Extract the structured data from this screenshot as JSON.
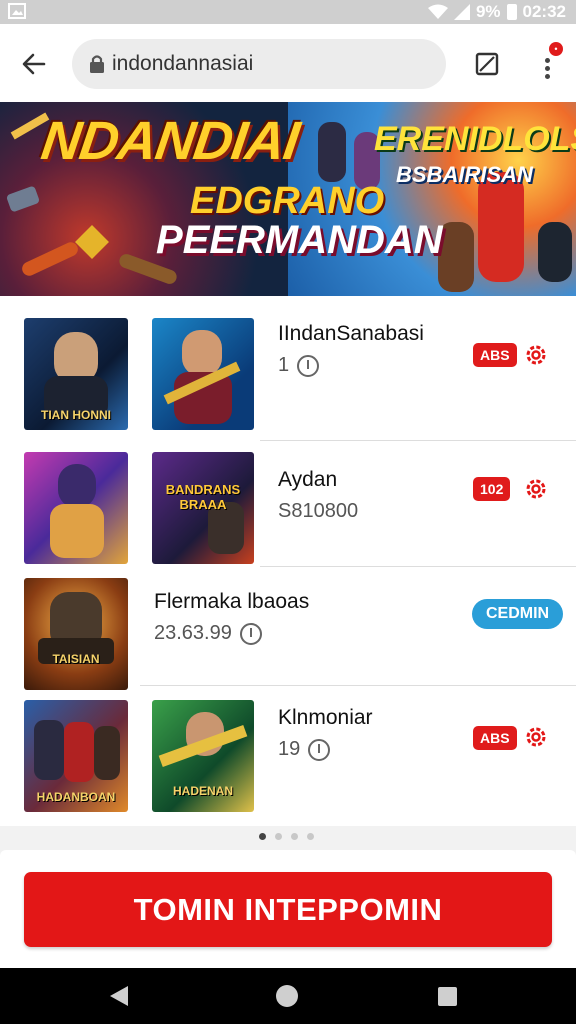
{
  "status_bar": {
    "battery": "9%",
    "time": "02:32"
  },
  "browser": {
    "url": "indondannasiai",
    "icons": [
      "back-arrow-icon",
      "lock-icon",
      "tabs-icon",
      "more-vert-icon"
    ]
  },
  "banner": {
    "title": "NDANDIAI",
    "subtitle1": "EDGRANO",
    "subtitle2": "PEERMANDAN",
    "right_title": "ERENIDLOLS",
    "right_subtitle": "BSBAIRISAN"
  },
  "items": [
    {
      "thumb1_caption": "TIAN HONNI",
      "thumb2_caption": "",
      "title": "IIndanSanabasi",
      "meta": "1",
      "badge": "ABS",
      "badge_type": "red"
    },
    {
      "thumb1_caption": "",
      "thumb2_caption": "BANDRANS BRAAA",
      "title": "Aydan",
      "meta": "S810800",
      "badge": "102",
      "badge_type": "red"
    },
    {
      "thumb1_caption": "TAISIAN",
      "title": "Flermaka lbaoas",
      "meta": "23.63.99",
      "badge": "CEDMIN",
      "badge_type": "blue"
    },
    {
      "thumb1_caption": "HADANBOAN",
      "thumb2_caption": "HADENAN",
      "title": "Klnmoniar",
      "meta": "19",
      "badge": "ABS",
      "badge_type": "red"
    }
  ],
  "cta": {
    "label": "TOMIN INTEPPOMIN"
  },
  "colors": {
    "accent": "#e31717",
    "blue_badge": "#2a9ed8"
  }
}
